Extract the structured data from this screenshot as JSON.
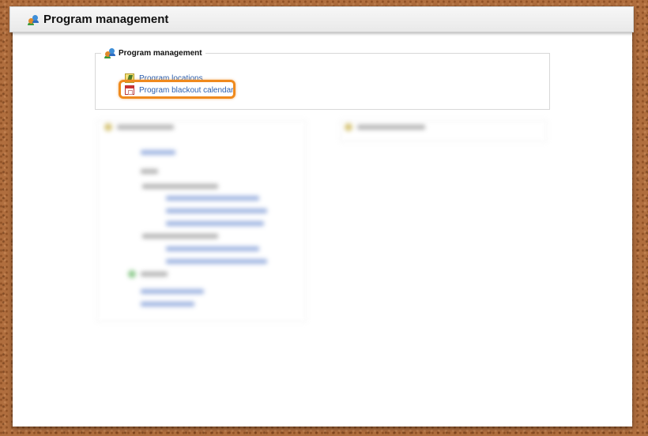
{
  "header": {
    "title": "Program management",
    "icon": "people-icon"
  },
  "section": {
    "legend": "Program management",
    "icon": "people-icon",
    "links": [
      {
        "label": "Program locations",
        "icon": "map-icon"
      },
      {
        "label": "Program blackout calendar",
        "icon": "calendar-icon"
      }
    ]
  },
  "highlight_color": "#ef8a1e",
  "link_color": "#2a5fb0"
}
